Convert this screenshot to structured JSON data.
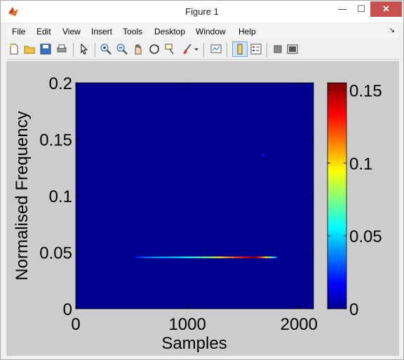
{
  "window": {
    "title": "Figure 1",
    "minimize": "—",
    "maximize": "☐",
    "close": "✕"
  },
  "menu": [
    "File",
    "Edit",
    "View",
    "Insert",
    "Tools",
    "Desktop",
    "Window",
    "Help"
  ],
  "menu_arrow": "↘",
  "toolbar_icons": [
    "new-figure-icon",
    "open-file-icon",
    "save-icon",
    "print-icon",
    "pointer-icon",
    "zoom-in-icon",
    "zoom-out-icon",
    "pan-hand-icon",
    "rotate-3d-icon",
    "data-cursor-icon",
    "brush-icon",
    "brush-dropdown-icon",
    "link-plot-icon",
    "colorbar-icon",
    "legend-icon",
    "hide-plot-tools-icon",
    "show-plot-tools-icon"
  ],
  "colors": {
    "plot_background": "#00008f",
    "figure_background": "#cccccc",
    "close_button": "#c75050"
  },
  "chart_data": {
    "type": "heatmap",
    "xlabel": "Samples",
    "ylabel": "Normalised Frequency",
    "xlim": [
      0,
      2130
    ],
    "ylim": [
      0,
      0.2
    ],
    "xticks": [
      "0",
      "1000",
      "2000"
    ],
    "xtick_values": [
      0,
      1000,
      2000
    ],
    "yticks": [
      "0",
      "0.05",
      "0.1",
      "0.15",
      "0.2"
    ],
    "ytick_values": [
      0,
      0.05,
      0.1,
      0.15,
      0.2
    ],
    "colorbar": {
      "colormap": "jet",
      "range": [
        0,
        0.155
      ],
      "ticks": [
        "0",
        "0.05",
        "0.1",
        "0.15"
      ],
      "tick_values": [
        0,
        0.05,
        0.1,
        0.15
      ]
    },
    "ridge": {
      "frequency": 0.0455,
      "points": [
        {
          "x": 530,
          "v": 0.02
        },
        {
          "x": 620,
          "v": 0.035
        },
        {
          "x": 760,
          "v": 0.045
        },
        {
          "x": 900,
          "v": 0.05
        },
        {
          "x": 1050,
          "v": 0.065
        },
        {
          "x": 1200,
          "v": 0.08
        },
        {
          "x": 1350,
          "v": 0.11
        },
        {
          "x": 1480,
          "v": 0.13
        },
        {
          "x": 1600,
          "v": 0.155
        },
        {
          "x": 1700,
          "v": 0.1
        },
        {
          "x": 1800,
          "v": 0.04
        }
      ]
    },
    "faint_feature": {
      "x": 1680,
      "y": 0.136,
      "v": 0.02
    }
  }
}
